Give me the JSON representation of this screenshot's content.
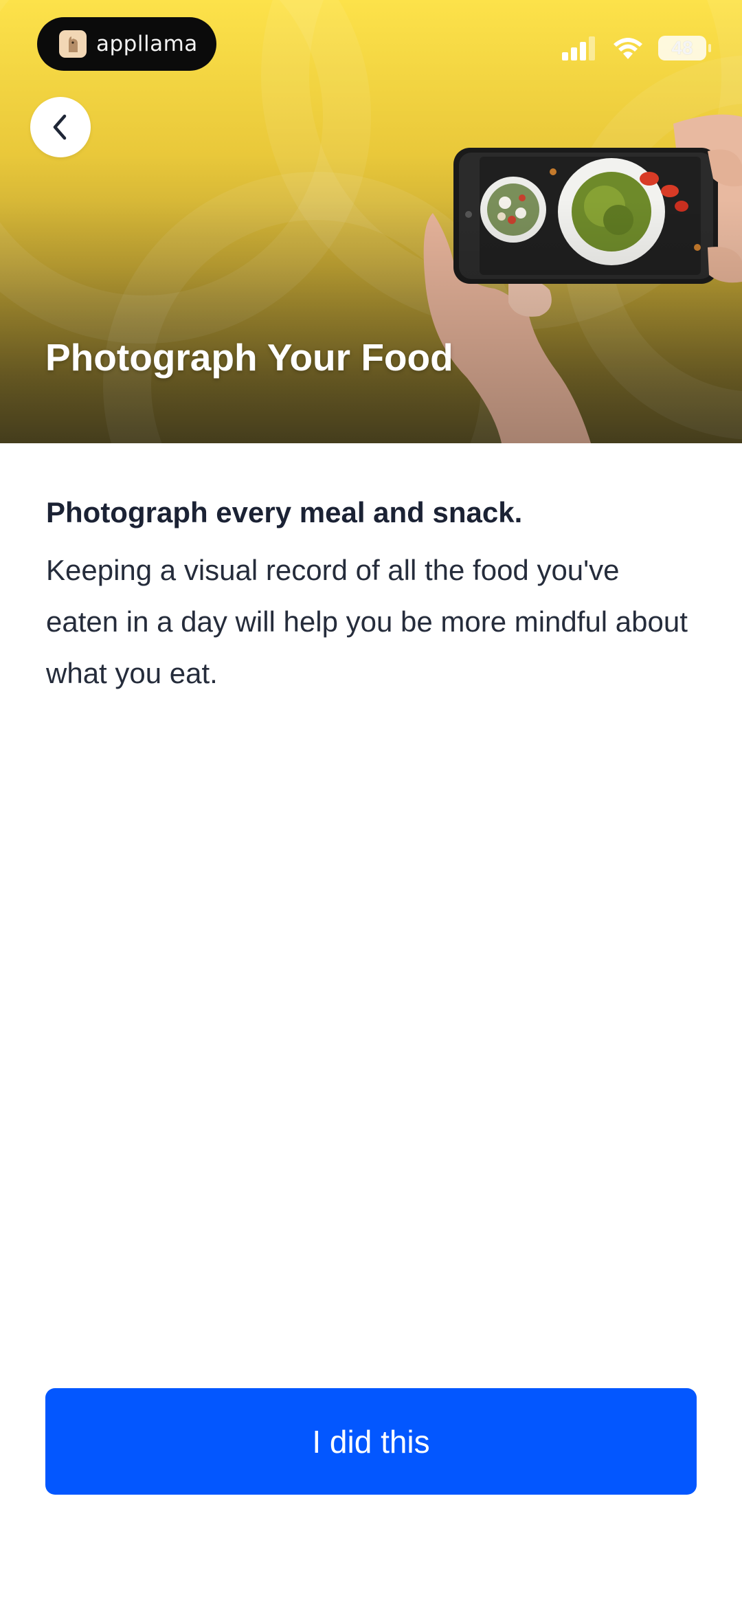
{
  "app": {
    "name": "appllama"
  },
  "status_bar": {
    "battery_level": "48"
  },
  "header": {
    "title": "Photograph Your Food"
  },
  "content": {
    "subtitle": "Photograph every meal and snack.",
    "body": "Keeping a visual record of all the food you've eaten in a day will help you be more mindful about what you eat."
  },
  "actions": {
    "primary_label": "I did this"
  },
  "colors": {
    "accent": "#0357ff",
    "hero_yellow": "#fde24a"
  },
  "icons": [
    "llama-logo-icon",
    "signal-icon",
    "wifi-icon",
    "battery-icon",
    "chevron-left-icon"
  ]
}
